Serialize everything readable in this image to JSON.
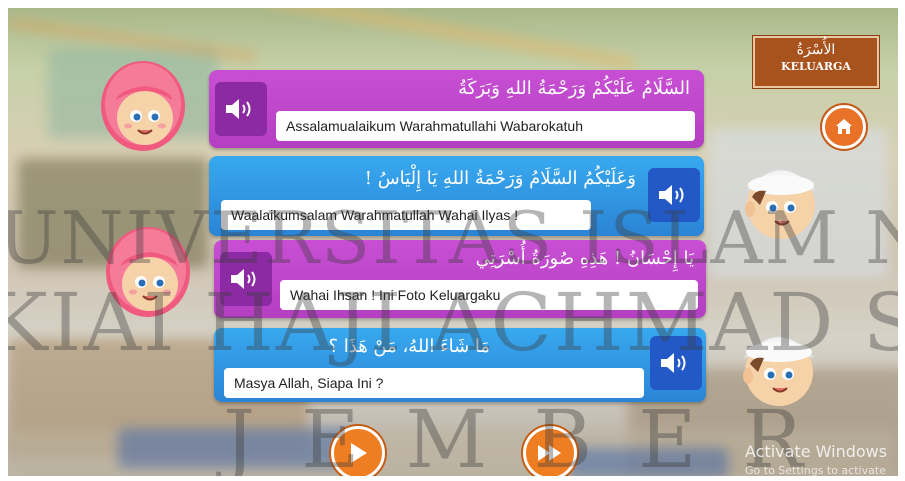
{
  "header": {
    "title_arabic": "الأُسْرَةُ",
    "title_latin": "KELUARGA"
  },
  "dialog": [
    {
      "speaker": "girl",
      "arabic": "السَّلَامُ عَلَيْكُمْ وَرَحْمَةُ اللهِ وَبَرَكَةُ",
      "latin": "Assalamualaikum Warahmatullahi Wabarokatuh"
    },
    {
      "speaker": "boy",
      "arabic": "وَعَلَيْكُمُ السَّلَامُ وَرَحْمَةُ اللهِ يَا إِلْيَاسُ !",
      "latin": "Waalaikumsalam Warahmatullah Wahai Ilyas !"
    },
    {
      "speaker": "girl",
      "arabic": "يَا إِحْسَانُ ! هَذِهِ صُورَةُ أُسْرَتِي",
      "latin": "Wahai Ihsan ! Ini Foto Keluargaku"
    },
    {
      "speaker": "boy",
      "arabic": "مَا شَاءَ اللهُ، مَنْ هَذَا ؟",
      "latin": "Masya Allah, Siapa Ini ?"
    }
  ],
  "icons": {
    "speaker": "speaker-icon",
    "home": "home-icon",
    "play": "play-icon",
    "next": "fast-forward-icon"
  },
  "watermark": {
    "line1": "UNIVERSITAS ISLAM NEGERI",
    "line2": "KIAI HAJI ACHMAD SIDDIQ",
    "line3": "JEMBER"
  },
  "os_notice": {
    "title": "Activate Windows",
    "subtitle": "Go to Settings to activate"
  },
  "colors": {
    "pink_bubble": "#c84fd3",
    "blue_bubble": "#38a9ef",
    "orange_button": "#ef7d22",
    "badge": "#a8531e"
  }
}
